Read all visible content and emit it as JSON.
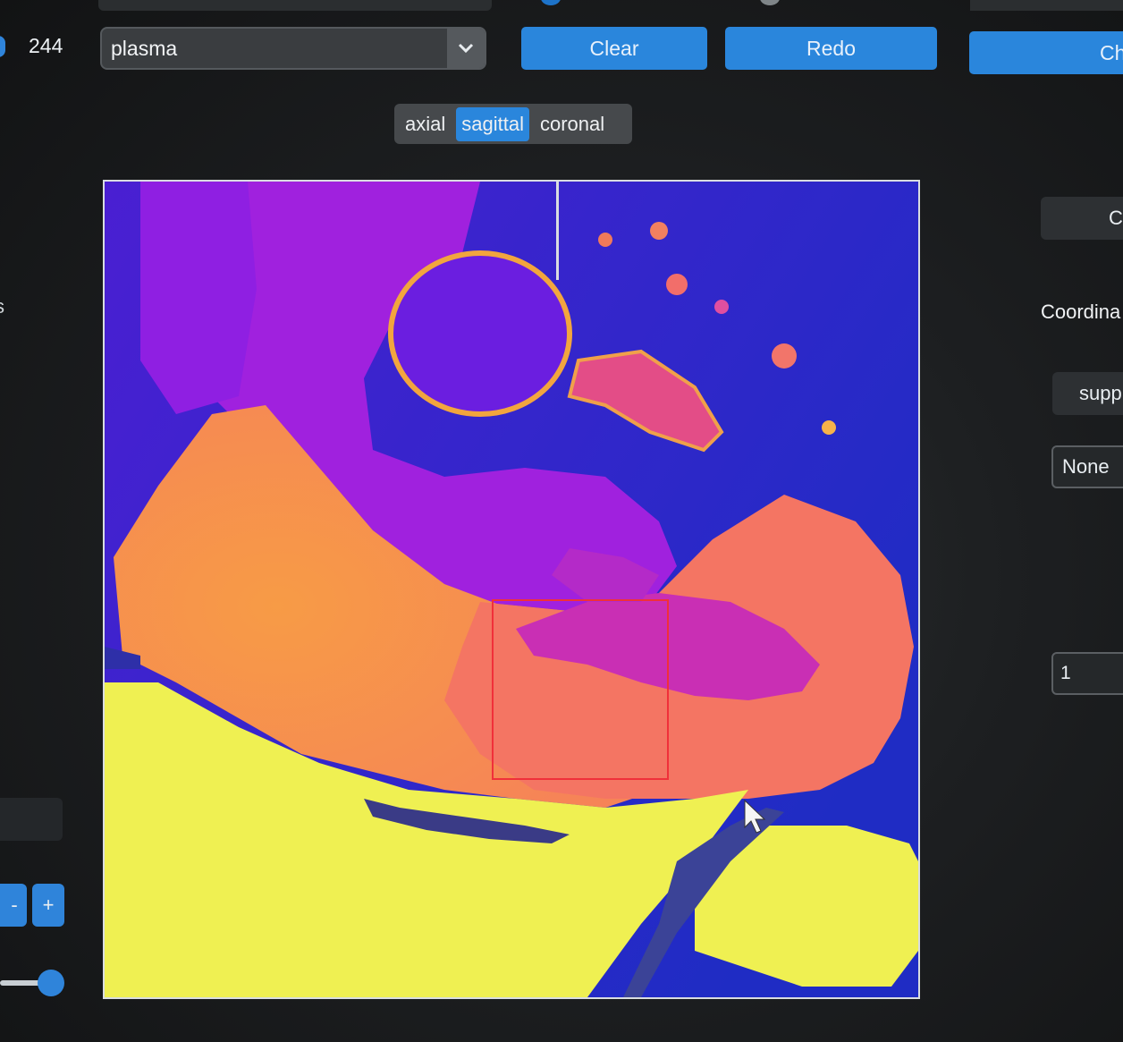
{
  "controls": {
    "slice_value": "244",
    "colormap": "plasma",
    "clear_label": "Clear",
    "redo_label": "Redo",
    "ch_label": "Ch"
  },
  "view_tabs": {
    "items": [
      "axial",
      "sagittal",
      "coronal"
    ],
    "active": "sagittal"
  },
  "right_panel": {
    "btn_partial": "C",
    "coordinates_label": "Coordina",
    "supp_label": "supp",
    "none_value": "None",
    "number_value": "1"
  },
  "left_panel": {
    "partial_text": "s",
    "minus_label": "-",
    "plus_label": "+",
    "slider_level": 0.95
  },
  "colors": {
    "accent": "#2a86dc",
    "plasma_dark": "#2a2dc8",
    "plasma_purple": "#9d1fe0",
    "plasma_pink": "#e0489a",
    "plasma_coral": "#f27462",
    "plasma_orange": "#f99a45",
    "plasma_yellow": "#eef052",
    "roi_box": "#f0303a"
  }
}
